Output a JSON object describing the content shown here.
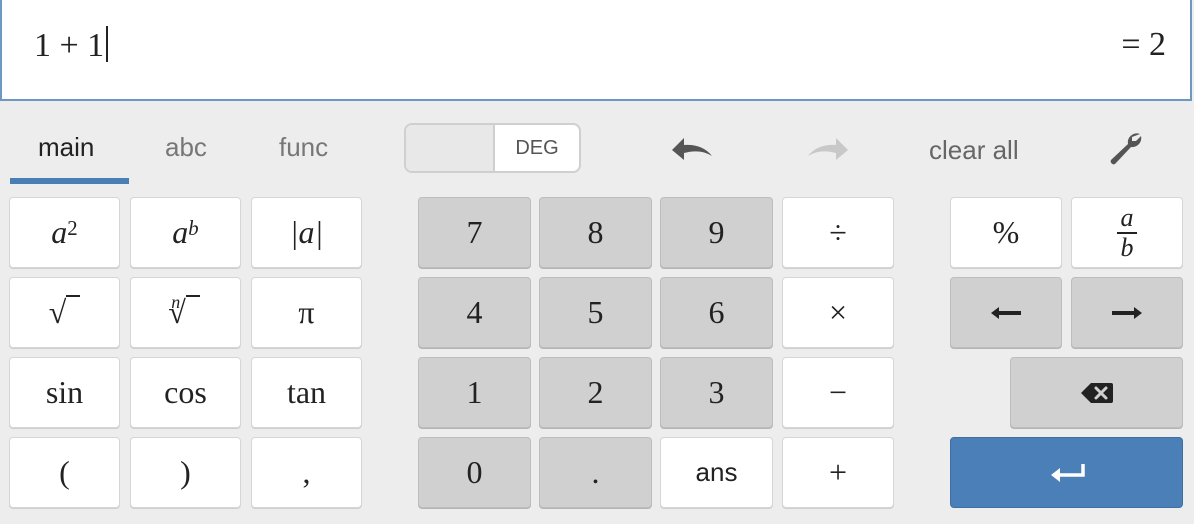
{
  "expression": {
    "input": "1 + 1",
    "result": "= 2"
  },
  "toolbar": {
    "tabs": [
      {
        "label": "main",
        "active": true
      },
      {
        "label": "abc",
        "active": false
      },
      {
        "label": "func",
        "active": false
      }
    ],
    "angle_mode": "DEG",
    "undo_icon": "undo-arrow-icon",
    "redo_icon": "redo-arrow-icon",
    "clear_all": "clear all",
    "settings_icon": "wrench-icon"
  },
  "keypad": {
    "functions": {
      "square": {
        "base": "a",
        "exp": "2"
      },
      "power": {
        "base": "a",
        "exp": "b"
      },
      "abs": "|a|",
      "sqrt": "√",
      "nthroot": {
        "index": "n",
        "root": "√"
      },
      "pi": "π",
      "sin": "sin",
      "cos": "cos",
      "tan": "tan",
      "lparen": "(",
      "rparen": ")",
      "comma": ","
    },
    "numbers": {
      "k7": "7",
      "k8": "8",
      "k9": "9",
      "k4": "4",
      "k5": "5",
      "k6": "6",
      "k1": "1",
      "k2": "2",
      "k3": "3",
      "k0": "0",
      "kdot": ".",
      "ans": "ans"
    },
    "operators": {
      "divide": "÷",
      "times": "×",
      "minus": "−",
      "plus": "+"
    },
    "extras": {
      "percent": "%",
      "fraction": {
        "num": "a",
        "den": "b"
      },
      "left_icon": "left-arrow-icon",
      "right_icon": "right-arrow-icon",
      "backspace_icon": "backspace-icon",
      "enter_icon": "enter-icon"
    },
    "colors": {
      "accent": "#4a7fb7",
      "gray_key": "#d0d0d0",
      "white_key": "#ffffff"
    }
  }
}
